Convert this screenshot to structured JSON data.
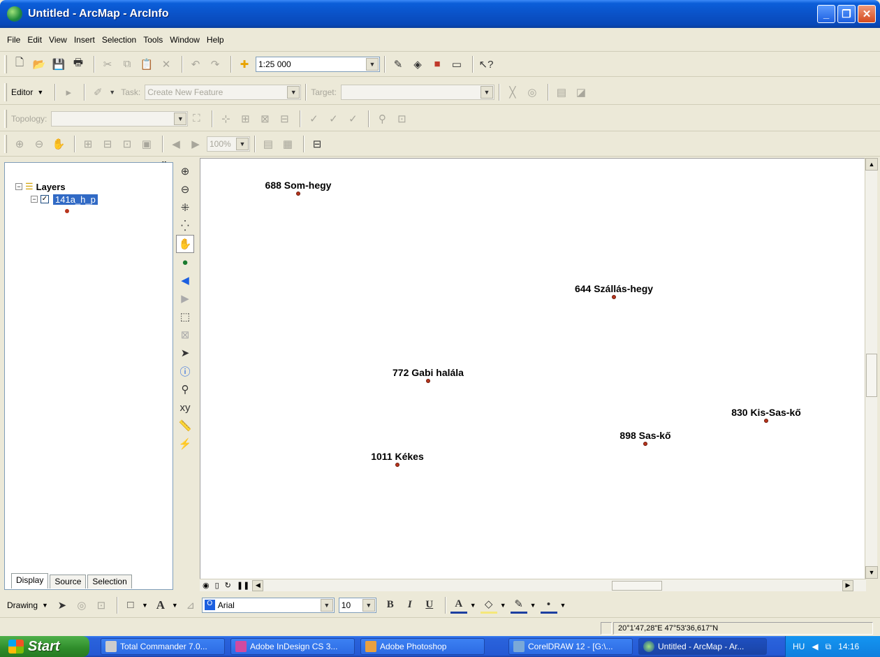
{
  "window": {
    "title": "Untitled - ArcMap - ArcInfo"
  },
  "menu": [
    "File",
    "Edit",
    "View",
    "Insert",
    "Selection",
    "Tools",
    "Window",
    "Help"
  ],
  "standard_toolbar": {
    "scale": "1:25 000"
  },
  "editor_toolbar": {
    "editor_label": "Editor",
    "task_label": "Task:",
    "task_value": "Create New Feature",
    "target_label": "Target:",
    "target_value": ""
  },
  "topology_toolbar": {
    "label": "Topology:",
    "value": ""
  },
  "layout_toolbar": {
    "zoom": "100%"
  },
  "toc": {
    "root": "Layers",
    "layer": "141a_h_p",
    "tabs": [
      "Display",
      "Source",
      "Selection"
    ]
  },
  "map": {
    "features": [
      {
        "label": "688 Som-hegy"
      },
      {
        "label": "644 Szállás-hegy"
      },
      {
        "label": "772 Gabi halála"
      },
      {
        "label": "830 Kis-Sas-kő"
      },
      {
        "label": "898 Sas-kő"
      },
      {
        "label": "1011 Kékes"
      }
    ]
  },
  "drawing_toolbar": {
    "label": "Drawing",
    "font": "Arial",
    "size": "10"
  },
  "status": {
    "coordinates": "20°1'47,28\"E  47°53'36,617\"N"
  },
  "taskbar": {
    "start": "Start",
    "tasks": [
      "Total Commander 7.0...",
      "Adobe InDesign CS 3...",
      "Adobe Photoshop",
      "CorelDRAW 12 - [G:\\...",
      "Untitled - ArcMap - Ar..."
    ],
    "lang": "HU",
    "clock": "14:16"
  }
}
